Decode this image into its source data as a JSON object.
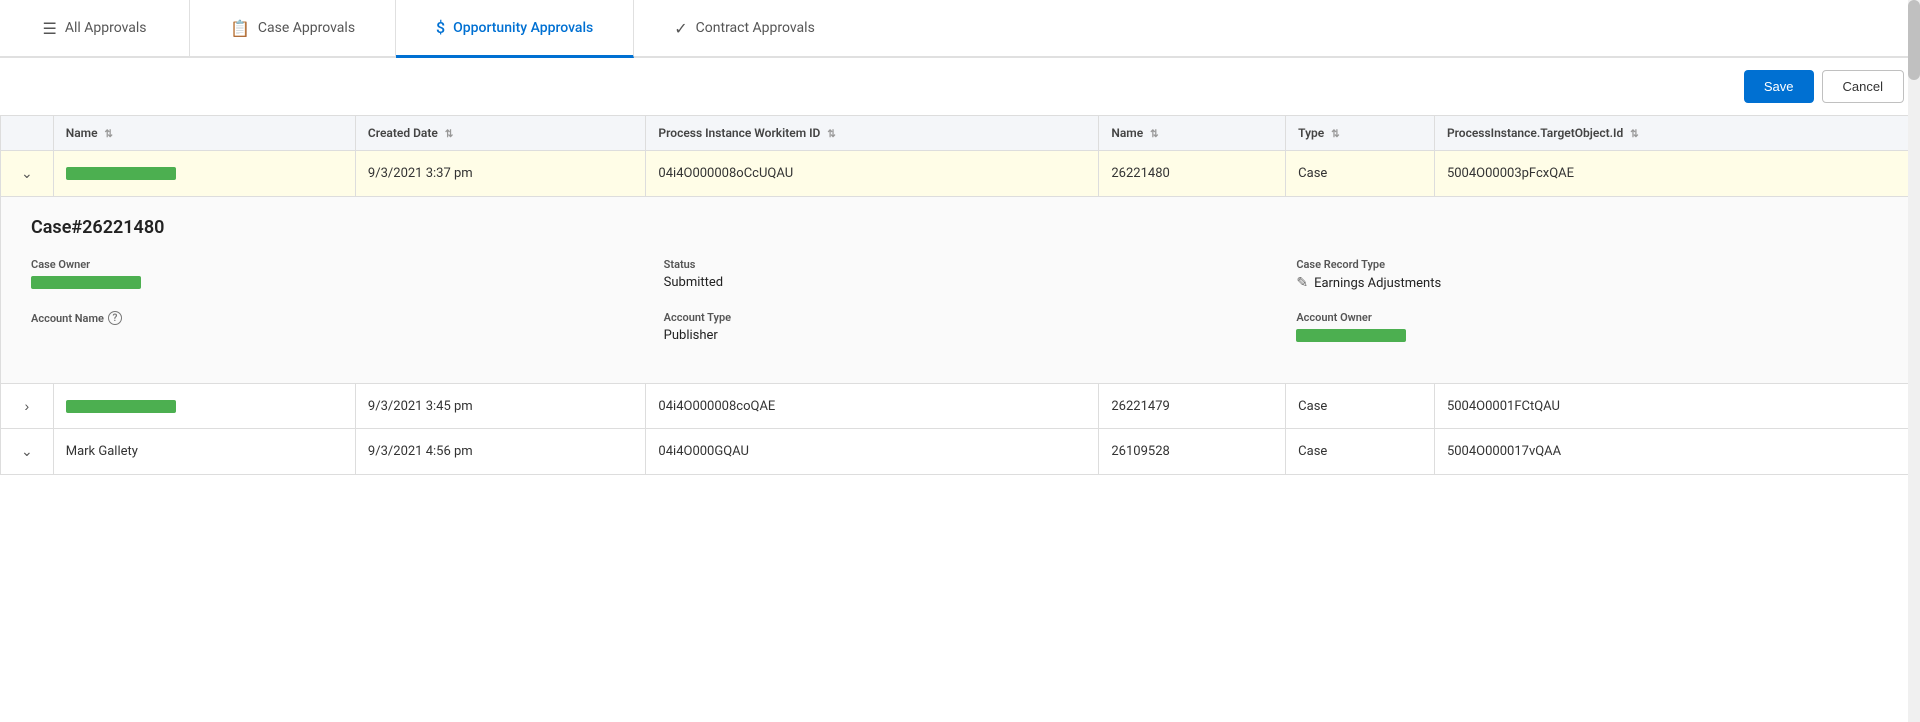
{
  "tabs": [
    {
      "id": "all",
      "label": "All Approvals",
      "icon": "≡",
      "active": false
    },
    {
      "id": "case",
      "label": "Case Approvals",
      "icon": "📋",
      "active": false
    },
    {
      "id": "opportunity",
      "label": "Opportunity Approvals",
      "icon": "$",
      "active": true
    },
    {
      "id": "contract",
      "label": "Contract Approvals",
      "icon": "✓",
      "active": false
    }
  ],
  "toolbar": {
    "save_label": "Save",
    "cancel_label": "Cancel"
  },
  "table": {
    "columns": [
      {
        "id": "expand",
        "label": ""
      },
      {
        "id": "name",
        "label": "Name"
      },
      {
        "id": "created_date",
        "label": "Created Date"
      },
      {
        "id": "process_instance_workitem_id",
        "label": "Process Instance Workitem ID"
      },
      {
        "id": "name2",
        "label": "Name"
      },
      {
        "id": "type",
        "label": "Type"
      },
      {
        "id": "process_instance_target_object_id",
        "label": "ProcessInstance.TargetObject.Id"
      }
    ],
    "rows": [
      {
        "expanded": true,
        "name_redacted": true,
        "name_width": "md",
        "created_date": "9/3/2021 3:37 pm",
        "process_instance_workitem_id": "04i4O000008oCcUQAU",
        "name2": "26221480",
        "type": "Case",
        "target_object_id": "5004O00003pFcxQAE",
        "detail": {
          "title": "Case#26221480",
          "case_owner_label": "Case Owner",
          "case_owner_redacted": true,
          "status_label": "Status",
          "status_value": "Submitted",
          "case_record_type_label": "Case Record Type",
          "case_record_type_value": "Earnings Adjustments",
          "account_name_label": "Account Name",
          "account_type_label": "Account Type",
          "account_type_value": "Publisher",
          "account_owner_label": "Account Owner",
          "account_owner_redacted": true
        }
      },
      {
        "expanded": false,
        "name_redacted": true,
        "name_width": "md",
        "created_date": "9/3/2021 3:45 pm",
        "process_instance_workitem_id": "04i4O000008coQAE",
        "name2": "26221479",
        "type": "Case",
        "target_object_id": "5004O0001FCtQAU"
      },
      {
        "expanded": true,
        "name_text": "Mark Gallety",
        "created_date": "9/3/2021 4:56 pm",
        "process_instance_workitem_id": "04i4O000GQAU",
        "name2": "26109528",
        "type": "Case",
        "target_object_id": "5004O000017vQAA"
      }
    ]
  }
}
